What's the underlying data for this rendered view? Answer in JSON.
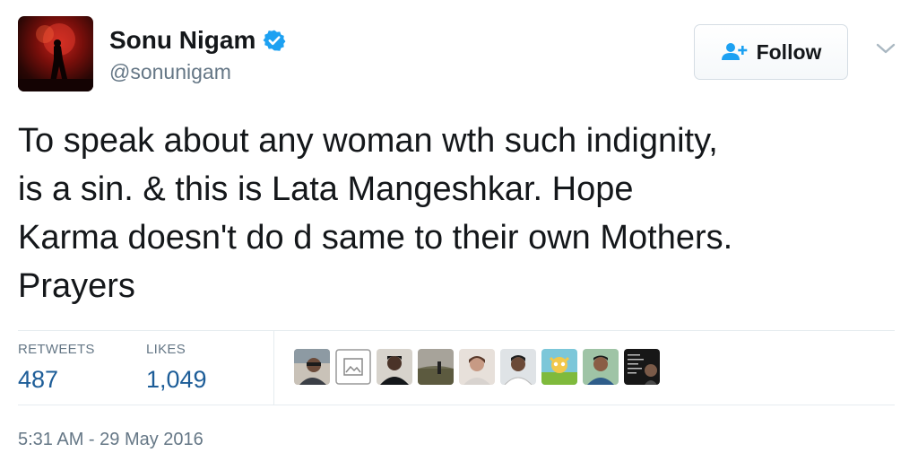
{
  "author": {
    "name": "Sonu Nigam",
    "handle": "@sonunigam",
    "verified": true,
    "avatar_icon": "profile-photo-concert"
  },
  "follow_button": {
    "label": "Follow",
    "icon": "add-user-icon"
  },
  "menu": {
    "icon": "chevron-down-icon"
  },
  "tweet": {
    "text": "To speak about any woman wth such indignity,\nis a sin. & this is Lata Mangeshkar. Hope\nKarma doesn't do d same to their own Mothers.\nPrayers"
  },
  "stats": {
    "retweets_label": "RETWEETS",
    "retweets_value": "487",
    "likes_label": "LIKES",
    "likes_value": "1,049"
  },
  "likers_count_shown": 9,
  "timestamp": "5:31 AM - 29 May 2016",
  "colors": {
    "accent_blue": "#1da1f2",
    "stat_blue": "#1d5d98",
    "muted": "#657786",
    "border": "#e6ecf0"
  }
}
